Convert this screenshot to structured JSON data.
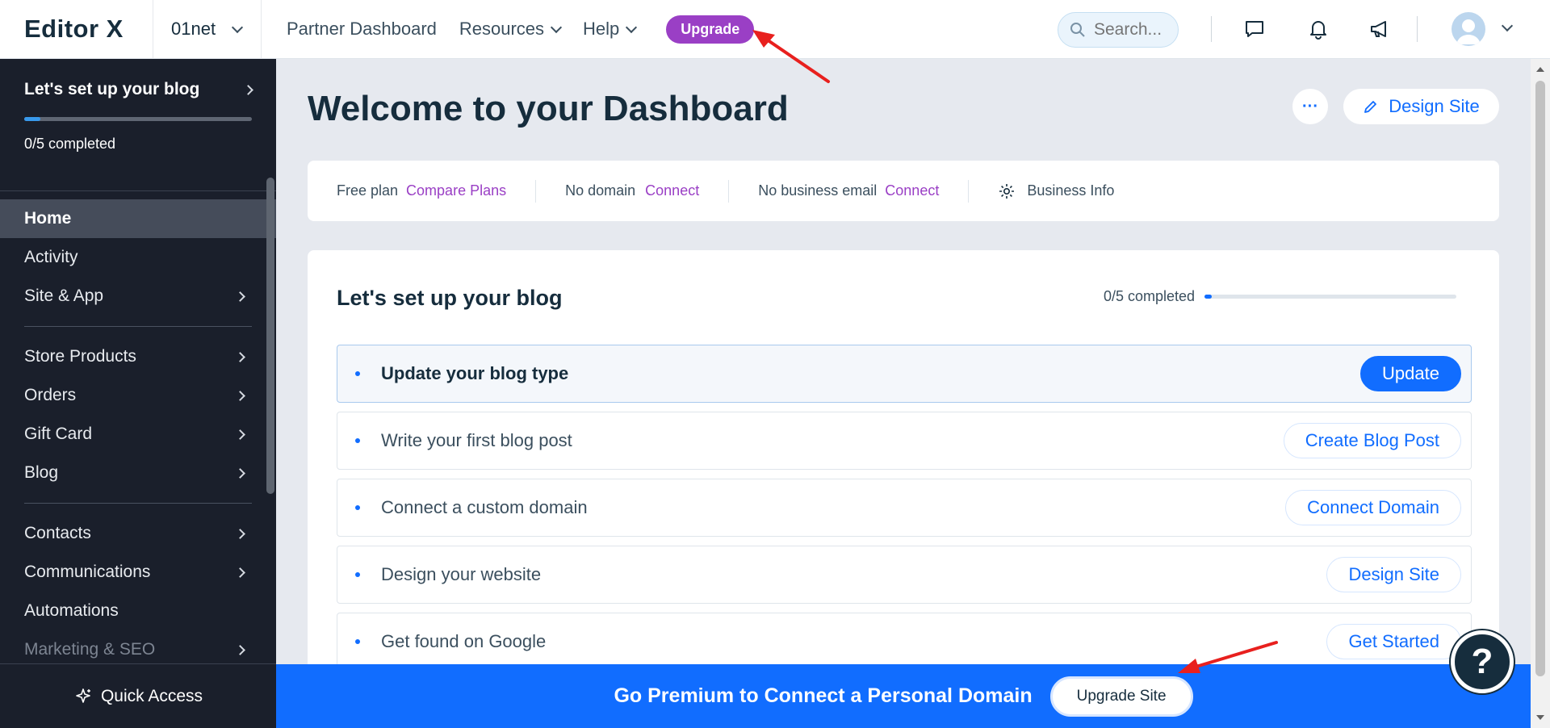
{
  "topbar": {
    "logo": "Editor X",
    "site_name": "01net",
    "nav": [
      {
        "label": "Partner Dashboard",
        "has_dropdown": false
      },
      {
        "label": "Resources",
        "has_dropdown": true
      },
      {
        "label": "Help",
        "has_dropdown": true
      }
    ],
    "upgrade_label": "Upgrade",
    "search_placeholder": "Search...",
    "icons": [
      "chat-icon",
      "bell-icon",
      "megaphone-icon"
    ]
  },
  "sidebar": {
    "setup_title": "Let's set up your blog",
    "setup_progress": 0.07,
    "setup_count": "0/5 completed",
    "items": [
      {
        "label": "Home",
        "active": true,
        "chevron": false
      },
      {
        "label": "Activity",
        "chevron": false
      },
      {
        "label": "Site & App",
        "chevron": true
      },
      {
        "label": "Store Products",
        "chevron": true
      },
      {
        "label": "Orders",
        "chevron": true
      },
      {
        "label": "Gift Card",
        "chevron": true
      },
      {
        "label": "Blog",
        "chevron": true
      },
      {
        "label": "Contacts",
        "chevron": true
      },
      {
        "label": "Communications",
        "chevron": true
      },
      {
        "label": "Automations",
        "chevron": false
      },
      {
        "label": "Marketing & SEO",
        "chevron": true
      }
    ],
    "quick_access": "Quick Access"
  },
  "main": {
    "title": "Welcome to your Dashboard",
    "more_label": "···",
    "design_site_label": "Design Site",
    "plan": {
      "free_plan": "Free plan",
      "compare_plans": "Compare Plans",
      "no_domain": "No domain",
      "connect_domain": "Connect",
      "no_email": "No business email",
      "connect_email": "Connect",
      "business_info": "Business Info"
    },
    "setup_card": {
      "title": "Let's set up your blog",
      "progress_text": "0/5 completed",
      "progress": 0.02,
      "tasks": [
        {
          "label": "Update your blog type",
          "button": "Update",
          "primary": true
        },
        {
          "label": "Write your first blog post",
          "button": "Create Blog Post",
          "primary": false
        },
        {
          "label": "Connect a custom domain",
          "button": "Connect Domain",
          "primary": false
        },
        {
          "label": "Design your website",
          "button": "Design Site",
          "primary": false
        },
        {
          "label": "Get found on Google",
          "button": "Get Started",
          "primary": false
        }
      ]
    }
  },
  "banner": {
    "text": "Go Premium to Connect a Personal Domain",
    "button": "Upgrade Site"
  },
  "help_label": "?",
  "colors": {
    "accent": "#116dff",
    "upgrade": "#9a3fc5",
    "sidebar_bg": "#1a1f2b",
    "annotation_arrow": "#e8201e"
  }
}
